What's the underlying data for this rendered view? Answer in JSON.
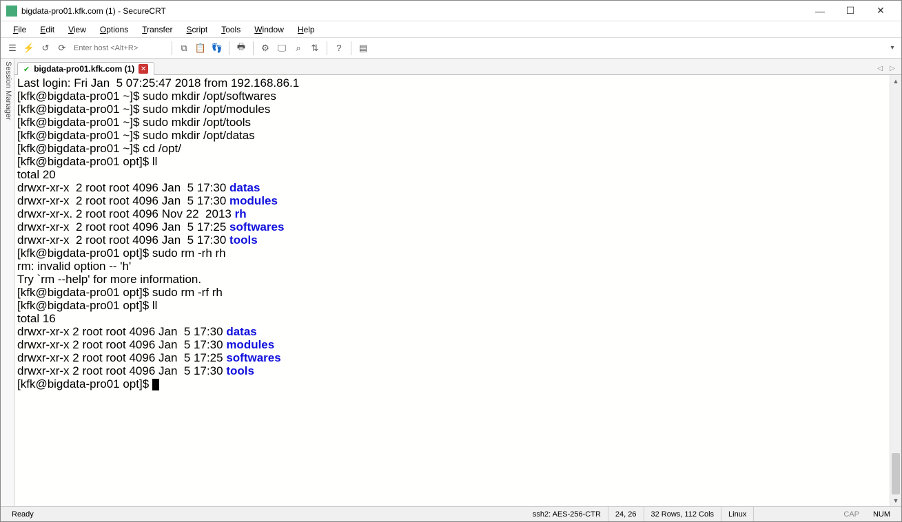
{
  "window": {
    "title": "bigdata-pro01.kfk.com (1) - SecureCRT"
  },
  "menu": {
    "items": [
      {
        "label": "File",
        "ul": "F"
      },
      {
        "label": "Edit",
        "ul": "E"
      },
      {
        "label": "View",
        "ul": "V"
      },
      {
        "label": "Options",
        "ul": "O"
      },
      {
        "label": "Transfer",
        "ul": "T"
      },
      {
        "label": "Script",
        "ul": "S"
      },
      {
        "label": "Tools",
        "ul": "T"
      },
      {
        "label": "Window",
        "ul": "W"
      },
      {
        "label": "Help",
        "ul": "H"
      }
    ]
  },
  "toolbar": {
    "host_placeholder": "Enter host <Alt+R>"
  },
  "sidepanel": {
    "label": "Session Manager"
  },
  "tab": {
    "label": "bigdata-pro01.kfk.com (1)"
  },
  "terminal": {
    "lines": [
      {
        "segs": [
          {
            "t": "Last login: Fri Jan  5 07:25:47 2018 from 192.168.86.1"
          }
        ]
      },
      {
        "segs": [
          {
            "t": "[kfk@bigdata-pro01 ~]$ sudo mkdir /opt/softwares"
          }
        ]
      },
      {
        "segs": [
          {
            "t": "[kfk@bigdata-pro01 ~]$ sudo mkdir /opt/modules"
          }
        ]
      },
      {
        "segs": [
          {
            "t": "[kfk@bigdata-pro01 ~]$ sudo mkdir /opt/tools"
          }
        ]
      },
      {
        "segs": [
          {
            "t": "[kfk@bigdata-pro01 ~]$ sudo mkdir /opt/datas"
          }
        ]
      },
      {
        "segs": [
          {
            "t": "[kfk@bigdata-pro01 ~]$ cd /opt/"
          }
        ]
      },
      {
        "segs": [
          {
            "t": "[kfk@bigdata-pro01 opt]$ ll"
          }
        ]
      },
      {
        "segs": [
          {
            "t": "total 20"
          }
        ]
      },
      {
        "segs": [
          {
            "t": "drwxr-xr-x  2 root root 4096 Jan  5 17:30 "
          },
          {
            "t": "datas",
            "c": "dir"
          }
        ]
      },
      {
        "segs": [
          {
            "t": "drwxr-xr-x  2 root root 4096 Jan  5 17:30 "
          },
          {
            "t": "modules",
            "c": "dir"
          }
        ]
      },
      {
        "segs": [
          {
            "t": "drwxr-xr-x. 2 root root 4096 Nov 22  2013 "
          },
          {
            "t": "rh",
            "c": "dir"
          }
        ]
      },
      {
        "segs": [
          {
            "t": "drwxr-xr-x  2 root root 4096 Jan  5 17:25 "
          },
          {
            "t": "softwares",
            "c": "dir"
          }
        ]
      },
      {
        "segs": [
          {
            "t": "drwxr-xr-x  2 root root 4096 Jan  5 17:30 "
          },
          {
            "t": "tools",
            "c": "dir"
          }
        ]
      },
      {
        "segs": [
          {
            "t": "[kfk@bigdata-pro01 opt]$ sudo rm -rh rh"
          }
        ]
      },
      {
        "segs": [
          {
            "t": "rm: invalid option -- 'h'"
          }
        ]
      },
      {
        "segs": [
          {
            "t": "Try `rm --help' for more information."
          }
        ]
      },
      {
        "segs": [
          {
            "t": "[kfk@bigdata-pro01 opt]$ sudo rm -rf rh"
          }
        ]
      },
      {
        "segs": [
          {
            "t": "[kfk@bigdata-pro01 opt]$ ll"
          }
        ]
      },
      {
        "segs": [
          {
            "t": "total 16"
          }
        ]
      },
      {
        "segs": [
          {
            "t": "drwxr-xr-x 2 root root 4096 Jan  5 17:30 "
          },
          {
            "t": "datas",
            "c": "dir"
          }
        ]
      },
      {
        "segs": [
          {
            "t": "drwxr-xr-x 2 root root 4096 Jan  5 17:30 "
          },
          {
            "t": "modules",
            "c": "dir"
          }
        ]
      },
      {
        "segs": [
          {
            "t": "drwxr-xr-x 2 root root 4096 Jan  5 17:25 "
          },
          {
            "t": "softwares",
            "c": "dir"
          }
        ]
      },
      {
        "segs": [
          {
            "t": "drwxr-xr-x 2 root root 4096 Jan  5 17:30 "
          },
          {
            "t": "tools",
            "c": "dir"
          }
        ]
      },
      {
        "segs": [
          {
            "t": "[kfk@bigdata-pro01 opt]$ "
          }
        ],
        "cursor": true
      }
    ]
  },
  "status": {
    "ready": "Ready",
    "cipher": "ssh2: AES-256-CTR",
    "cursor": "24,  26",
    "size": "32 Rows, 112 Cols",
    "os": "Linux",
    "cap": "CAP",
    "num": "NUM"
  }
}
